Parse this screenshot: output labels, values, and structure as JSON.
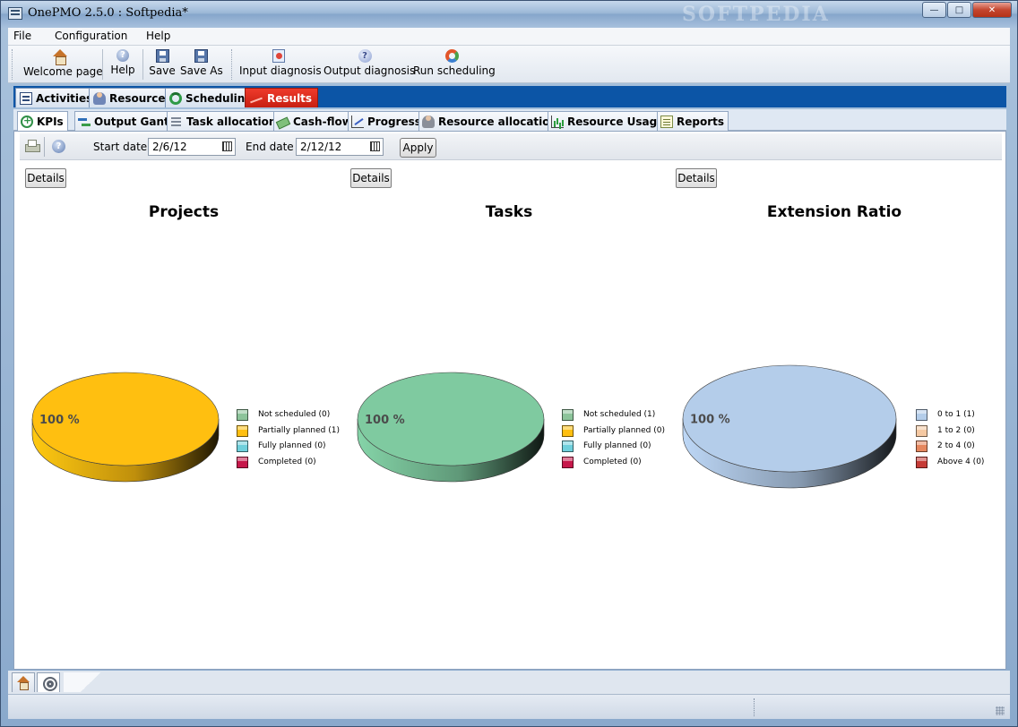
{
  "window": {
    "title": "OnePMO 2.5.0 : Softpedia*",
    "watermark": "SOFTPEDIA"
  },
  "menu": [
    "File",
    "Configuration",
    "Help"
  ],
  "toolbar": {
    "welcome": "Welcome page",
    "help": "Help",
    "save": "Save",
    "save_as": "Save As",
    "input_diagnosis": "Input diagnosis",
    "output_diagnosis": "Output diagnosis",
    "run_scheduling": "Run scheduling"
  },
  "main_tabs": [
    {
      "label": "Activities",
      "active": false
    },
    {
      "label": "Resources",
      "active": false
    },
    {
      "label": "Scheduling",
      "active": false
    },
    {
      "label": "Results",
      "active": true
    }
  ],
  "sub_tabs": [
    {
      "label": "KPIs",
      "active": true
    },
    {
      "label": "Output Gantt",
      "active": false
    },
    {
      "label": "Task allocations",
      "active": false
    },
    {
      "label": "Cash-flow",
      "active": false
    },
    {
      "label": "Progress",
      "active": false
    },
    {
      "label": "Resource allocations",
      "active": false
    },
    {
      "label": "Resource Usage",
      "active": false
    },
    {
      "label": "Reports",
      "active": false
    }
  ],
  "filter": {
    "start_label": "Start date",
    "start_value": "2/6/12",
    "end_label": "End date",
    "end_value": "2/12/12",
    "apply": "Apply"
  },
  "details_label": "Details",
  "chart_data": [
    {
      "type": "pie",
      "title": "Projects",
      "slices": [
        {
          "label": "Partially planned",
          "value": 100,
          "color": "#ffbf10"
        }
      ],
      "slice_label": "100 %",
      "legend": [
        {
          "label": "Not scheduled (0)",
          "color": "#8cc49a"
        },
        {
          "label": "Partially planned (1)",
          "color": "#ffbf10"
        },
        {
          "label": "Fully planned (0)",
          "color": "#6fd0dc"
        },
        {
          "label": "Completed (0)",
          "color": "#c6174a"
        }
      ]
    },
    {
      "type": "pie",
      "title": "Tasks",
      "slices": [
        {
          "label": "Not scheduled",
          "value": 100,
          "color": "#7fcaa0"
        }
      ],
      "slice_label": "100 %",
      "legend": [
        {
          "label": "Not scheduled (1)",
          "color": "#8cc49a"
        },
        {
          "label": "Partially planned (0)",
          "color": "#ffbf10"
        },
        {
          "label": "Fully planned (0)",
          "color": "#6fd0dc"
        },
        {
          "label": "Completed (0)",
          "color": "#c6174a"
        }
      ]
    },
    {
      "type": "pie",
      "title": "Extension Ratio",
      "slices": [
        {
          "label": "0 to 1",
          "value": 100,
          "color": "#b4cdea"
        }
      ],
      "slice_label": "100 %",
      "legend": [
        {
          "label": "0 to 1 (1)",
          "color": "#b4cdea"
        },
        {
          "label": "1 to 2 (0)",
          "color": "#f5c9a3"
        },
        {
          "label": "2 to 4 (0)",
          "color": "#e6875e"
        },
        {
          "label": "Above 4 (0)",
          "color": "#c63b36"
        }
      ]
    }
  ]
}
